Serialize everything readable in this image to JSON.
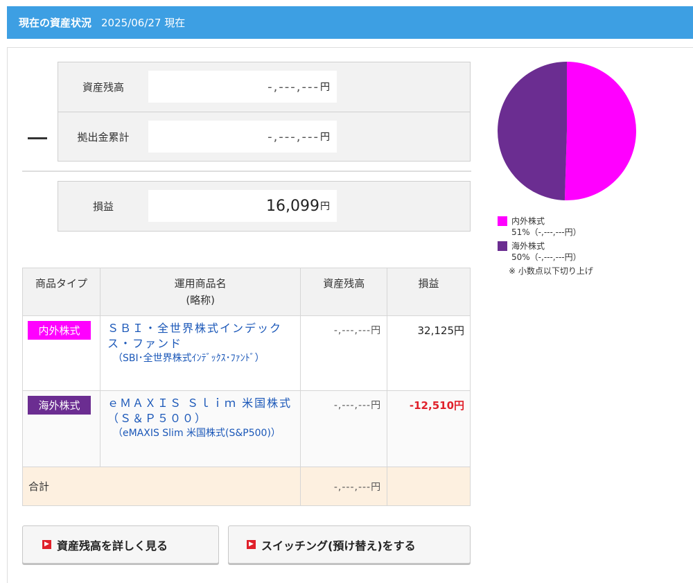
{
  "header": {
    "title": "現在の資産状況",
    "date": "2025/06/27 現在"
  },
  "summary": {
    "balance_label": "資産残高",
    "balance_value": "-,---,---",
    "contribution_label": "拠出金累計",
    "contribution_value": "-,---,---",
    "profit_label": "損益",
    "profit_value": "16,099",
    "yen": "円",
    "minus_sign": "—"
  },
  "table": {
    "headers": {
      "type": "商品タイプ",
      "name": "運用商品名",
      "name_sub": "(略称)",
      "balance": "資産残高",
      "profit": "損益"
    },
    "rows": [
      {
        "badge": "内外株式",
        "badge_color": "#ff00ff",
        "name": "ＳＢＩ・全世界株式インデックス・ファンド",
        "short": "（SBI･全世界株式ｲﾝﾃﾞｯｸｽ･ﾌｧﾝﾄﾞ）",
        "balance": "-,---,---円",
        "profit": "32,125円"
      },
      {
        "badge": "海外株式",
        "badge_color": "#6b2d91",
        "name": "ｅＭＡＸＩＳ Ｓｌｉｍ 米国株式（Ｓ＆Ｐ５００）",
        "short": "（eMAXIS Slim 米国株式(S&P500)）",
        "balance": "-,---,---円",
        "profit": "-12,510円"
      }
    ],
    "total_label": "合計",
    "total_balance": "-,---,---円"
  },
  "buttons": {
    "detail": "資産残高を詳しく見る",
    "switching": "スイッチング(預け替え)をする",
    "arrow": "▶"
  },
  "chart_data": {
    "type": "pie",
    "slices": [
      {
        "label": "内外株式",
        "percent": 51,
        "text": "51%（-,---,---円）",
        "color": "#ff00ff"
      },
      {
        "label": "海外株式",
        "percent": 50,
        "text": "50%（-,---,---円）",
        "color": "#6b2d91"
      }
    ],
    "note": "※ 小数点以下切り上げ"
  }
}
